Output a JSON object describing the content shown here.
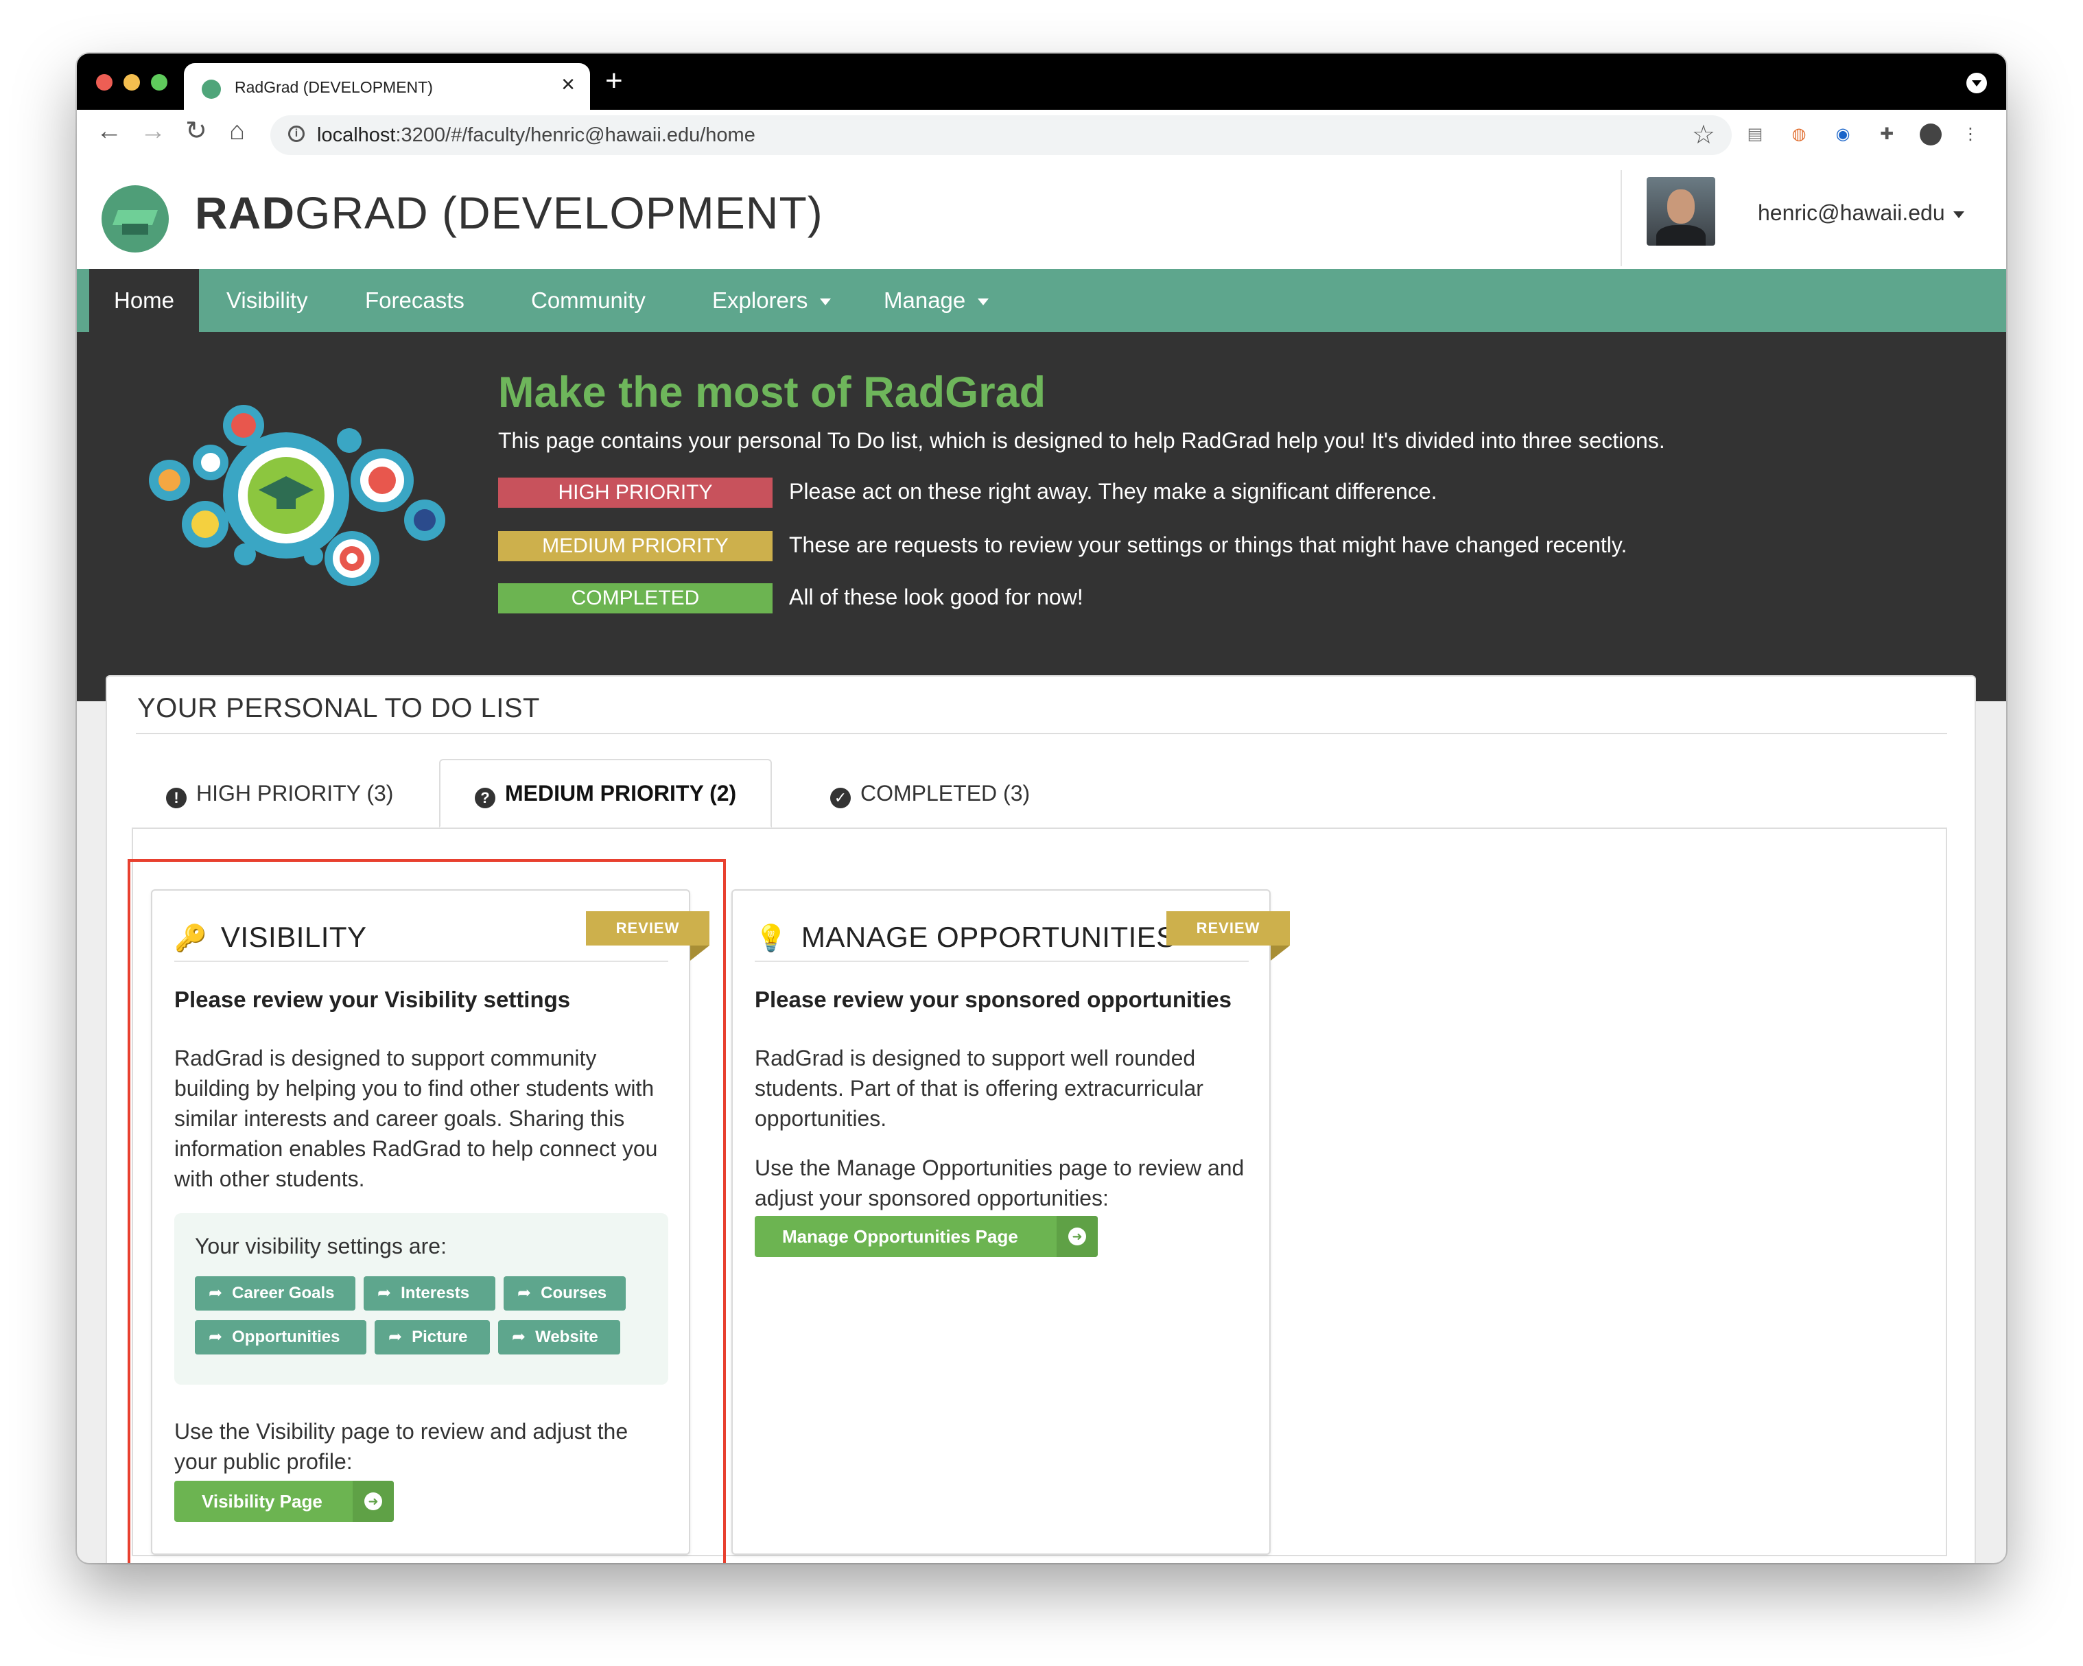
{
  "browser": {
    "tab_title": "RadGrad (DEVELOPMENT)",
    "url_host": "localhost",
    "url_rest": ":3200/#/faculty/henric@hawaii.edu/home"
  },
  "header": {
    "brand_bold": "RAD",
    "brand_rest": "GRAD (DEVELOPMENT)",
    "user_email": "henric@hawaii.edu"
  },
  "nav": {
    "items": [
      {
        "label": "Home",
        "active": true
      },
      {
        "label": "Visibility"
      },
      {
        "label": "Forecasts"
      },
      {
        "label": "Community"
      },
      {
        "label": "Explorers",
        "dropdown": true
      },
      {
        "label": "Manage",
        "dropdown": true
      }
    ]
  },
  "hero": {
    "title": "Make the most of RadGrad",
    "description": "This page contains your personal To Do list, which is designed to help RadGrad help you! It's divided into three sections.",
    "high_label": "HIGH PRIORITY",
    "high_text": "Please act on these right away. They make a significant difference.",
    "medium_label": "MEDIUM PRIORITY",
    "medium_text": "These are requests to review your settings or things that might have changed recently.",
    "completed_label": "COMPLETED",
    "completed_text": "All of these look good for now!"
  },
  "todo": {
    "header": "YOUR PERSONAL TO DO LIST",
    "tabs": [
      {
        "label": "HIGH PRIORITY (3)",
        "icon": "exclamation-circle-icon"
      },
      {
        "label": "MEDIUM PRIORITY (2)",
        "icon": "question-circle-icon",
        "active": true
      },
      {
        "label": "COMPLETED (3)",
        "icon": "check-circle-icon"
      }
    ]
  },
  "cards": {
    "visibility": {
      "title": "VISIBILITY",
      "ribbon": "REVIEW",
      "subtitle": "Please review your Visibility settings",
      "body": "RadGrad is designed to support community building by helping you to find other students with similar interests and career goals. Sharing this information enables RadGrad to help connect you with other students.",
      "settings_label": "Your visibility settings are:",
      "chips": [
        "Career Goals",
        "Interests",
        "Courses",
        "Opportunities",
        "Picture",
        "Website"
      ],
      "footer": "Use the Visibility page to review and adjust the your public profile:",
      "button": "Visibility Page"
    },
    "opportunities": {
      "title": "MANAGE OPPORTUNITIES",
      "ribbon": "REVIEW",
      "subtitle": "Please review your sponsored opportunities",
      "body1": "RadGrad is designed to support well rounded students. Part of that is offering extracurricular opportunities.",
      "body2": "Use the Manage Opportunities page to review and adjust your sponsored opportunities:",
      "button": "Manage Opportunities Page"
    }
  },
  "colors": {
    "accent": "#5ea68d",
    "high": "#c8525c",
    "medium": "#cdb04c",
    "completed": "#6cb451",
    "highlight": "#e8402f"
  }
}
